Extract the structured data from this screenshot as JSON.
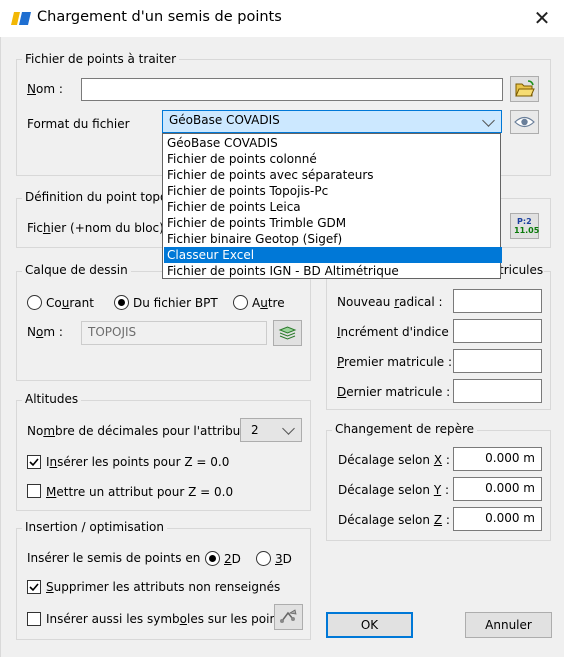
{
  "window": {
    "title": "Chargement d'un semis de points"
  },
  "fichier": {
    "legend": "Fichier de points à traiter",
    "nom_label": "Nom :",
    "nom_value": "",
    "format_label": "Format du fichier",
    "format_value": "GéoBase COVADIS",
    "format_options": [
      "GéoBase COVADIS",
      "Fichier de points colonné",
      "Fichier de points avec séparateurs",
      "Fichier de points Topojis-Pc",
      "Fichier de points Leica",
      "Fichier de points Trimble GDM",
      "Fichier binaire Geotop (Sigef)",
      "Classeur Excel",
      "Fichier de points IGN - BD Altimétrique"
    ],
    "highlighted_option": "Classeur Excel"
  },
  "definition": {
    "legend": "Définition du point topog",
    "fichier_label": "Fichier (+nom du bloc)",
    "icon_text_top": "P:2",
    "icon_text_bottom": "11.05"
  },
  "calque": {
    "legend": "Calque de dessin",
    "radio_courant": "Courant",
    "radio_fichier": "Du fichier BPT",
    "radio_autre": "Autre",
    "selected": "Du fichier BPT",
    "nom_label": "Nom :",
    "nom_value": "TOPOJIS"
  },
  "matricules": {
    "legend": "tricules",
    "nouveau_radical": "Nouveau radical :",
    "increment": "Incrément d'indice",
    "premier": "Premier matricule :",
    "dernier": "Dernier matricule :"
  },
  "altitudes": {
    "legend": "Altitudes",
    "decimales_label": "Nombre de décimales pour l'attribut",
    "decimales_value": "2",
    "inserer_z0": "Insérer les points pour Z = 0.0",
    "inserer_z0_checked": true,
    "mettre_attribut": "Mettre un attribut pour Z = 0.0",
    "mettre_attribut_checked": false
  },
  "repere": {
    "legend": "Changement de repère",
    "decalage_x_label": "Décalage selon X :",
    "decalage_x_value": "0.000 m",
    "decalage_y_label": "Décalage selon Y :",
    "decalage_y_value": "0.000 m",
    "decalage_z_label": "Décalage selon Z :",
    "decalage_z_value": "0.000 m"
  },
  "insertion": {
    "legend": "Insertion / optimisation",
    "semis_label": "Insérer le semis de points en",
    "radio_2d": "2D",
    "radio_3d": "3D",
    "selected": "2D",
    "supprimer": "Supprimer les attributs non renseignés",
    "supprimer_checked": true,
    "symboles": "Insérer aussi les symboles sur les points",
    "symboles_checked": false
  },
  "buttons": {
    "ok": "OK",
    "annuler": "Annuler"
  },
  "colors": {
    "accent": "#0078d7",
    "dialog_bg": "#f0f0f0",
    "group_border": "#d8d8d8"
  }
}
